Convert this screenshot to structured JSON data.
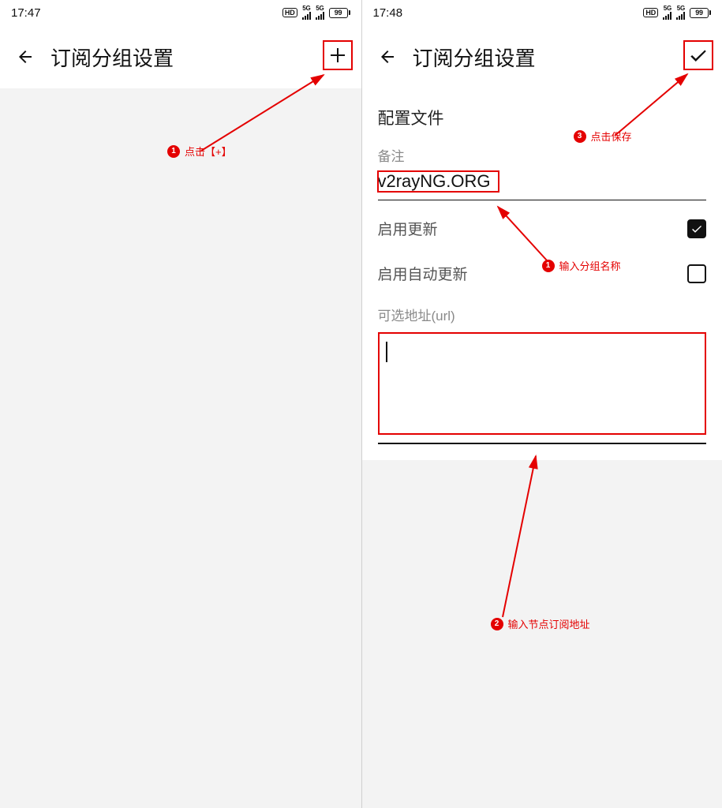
{
  "left": {
    "status": {
      "time": "17:47",
      "hd": "HD",
      "sig_tag": "5G",
      "battery_pct": "99"
    },
    "header": {
      "title": "订阅分组设置",
      "action_icon": "plus"
    },
    "annotations": {
      "a1": {
        "num": "1",
        "text": "点击【+】"
      }
    }
  },
  "right": {
    "status": {
      "time": "17:48",
      "hd": "HD",
      "sig_tag": "5G",
      "battery_pct": "99"
    },
    "header": {
      "title": "订阅分组设置",
      "action_icon": "check"
    },
    "form": {
      "section_title": "配置文件",
      "remark_label": "备注",
      "remark_value": "v2rayNG.ORG",
      "enable_update_label": "启用更新",
      "enable_update_checked": true,
      "enable_auto_update_label": "启用自动更新",
      "enable_auto_update_checked": false,
      "url_label": "可选地址(url)",
      "url_value": ""
    },
    "annotations": {
      "a1": {
        "num": "1",
        "text": "输入分组名称"
      },
      "a2": {
        "num": "2",
        "text": "输入节点订阅地址"
      },
      "a3": {
        "num": "3",
        "text": "点击保存"
      }
    }
  }
}
